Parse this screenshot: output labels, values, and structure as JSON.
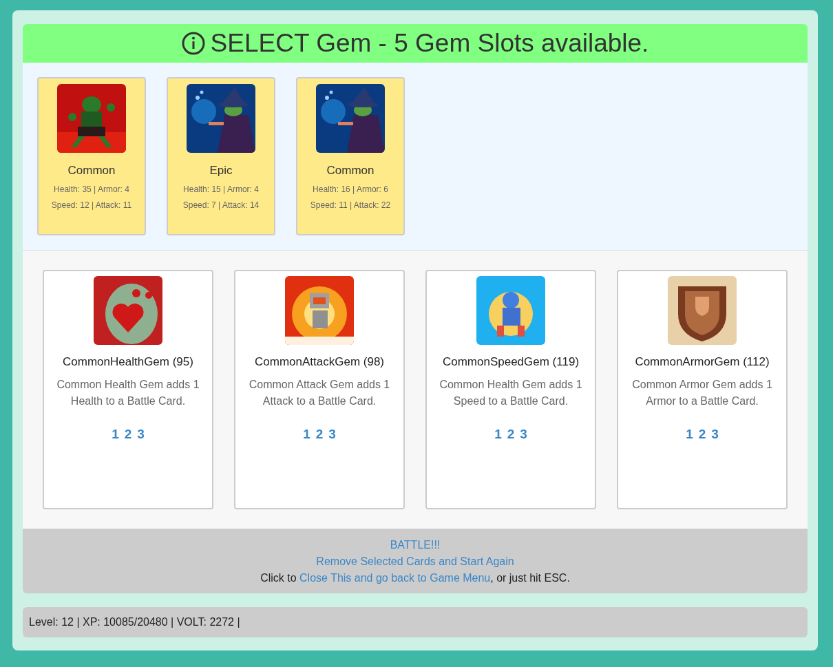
{
  "header": {
    "title": "SELECT Gem - 5 Gem Slots available."
  },
  "battle_cards": [
    {
      "kind": "picture",
      "rarity": "Common",
      "stats_line_1": "Health: 35 | Armor: 4",
      "stats_line_2": "Speed: 12 | Attack: 11"
    },
    {
      "kind": "picture",
      "rarity": "Epic",
      "stats_line_1": "Health: 15 | Armor: 4",
      "stats_line_2": "Speed: 7 | Attack: 14"
    },
    {
      "kind": "picture",
      "rarity": "Common",
      "stats_line_1": "Health: 16 | Armor: 6",
      "stats_line_2": "Speed: 11 | Attack: 22"
    }
  ],
  "gems": [
    {
      "kind": "picture",
      "name": "CommonHealthGem (95)",
      "description": "Common Health Gem adds 1 Health to a Battle Card.",
      "slots": [
        "1",
        "2",
        "3"
      ]
    },
    {
      "kind": "picture",
      "name": "CommonAttackGem (98)",
      "description": "Common Attack Gem adds 1 Attack to a Battle Card.",
      "slots": [
        "1",
        "2",
        "3"
      ]
    },
    {
      "kind": "picture",
      "name": "CommonSpeedGem (119)",
      "description": "Common Health Gem adds 1 Speed to a Battle Card.",
      "slots": [
        "1",
        "2",
        "3"
      ]
    },
    {
      "kind": "picture",
      "name": "CommonArmorGem (112)",
      "description": "Common Armor Gem adds 1 Armor to a Battle Card.",
      "slots": [
        "1",
        "2",
        "3"
      ]
    }
  ],
  "footer": {
    "battle_link": "BATTLE!!!",
    "remove_link": "Remove Selected Cards and Start Again",
    "close_prefix": "Click to ",
    "close_link": "Close This and go back to Game Menu",
    "close_suffix": ", or just hit ESC."
  },
  "status_bar": {
    "text": "Level: 12 | XP: 10085/20480 | VOLT: 2272 |"
  }
}
